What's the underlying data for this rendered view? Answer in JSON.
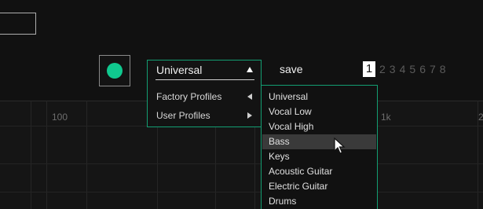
{
  "graph": {
    "axis_labels": [
      "100",
      "1k",
      "2"
    ]
  },
  "record": {
    "color": "#10c98f"
  },
  "profile": {
    "selected": "Universal",
    "submenu": [
      {
        "label": "Factory Profiles",
        "arrow": "left"
      },
      {
        "label": "User Profiles",
        "arrow": "right"
      }
    ],
    "accent_color": "#139e72"
  },
  "toolbar": {
    "save_label": "save"
  },
  "pages": {
    "items": [
      "1",
      "2",
      "3",
      "4",
      "5",
      "6",
      "7",
      "8"
    ],
    "active": "1"
  },
  "profile_list": {
    "items": [
      "Universal",
      "Vocal Low",
      "Vocal High",
      "Bass",
      "Keys",
      "Acoustic Guitar",
      "Electric Guitar",
      "Drums"
    ],
    "hovered": "Bass"
  },
  "icons": {
    "cursor": "mouse-pointer-icon",
    "dropdown_arrow": "triangle-up-icon",
    "submenu_left": "triangle-left-icon",
    "submenu_right": "triangle-right-icon"
  }
}
